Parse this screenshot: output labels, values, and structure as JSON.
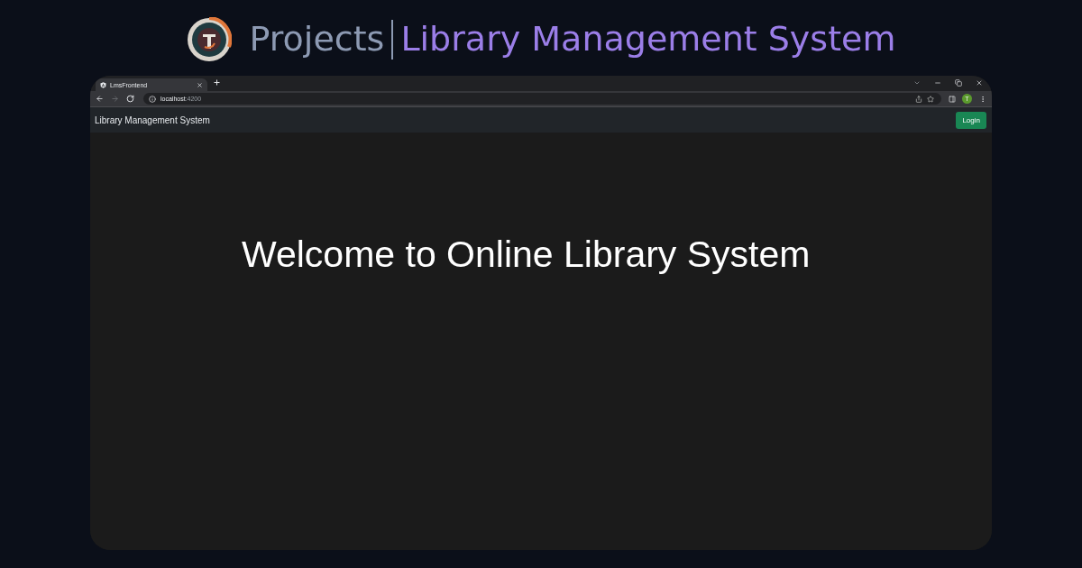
{
  "header": {
    "section": "Projects",
    "title": "Library Management System"
  },
  "browser": {
    "tabs": [
      {
        "title": "LmsFrontend",
        "selected": true
      }
    ],
    "navigation": {
      "forward_disabled": true
    },
    "address": {
      "host": "localhost",
      "port": ":4200"
    },
    "profile_initial": "T"
  },
  "navbar": {
    "brand": "Library Management System",
    "login_button": "Login"
  },
  "main": {
    "heading": "Welcome to Online Library System"
  }
}
